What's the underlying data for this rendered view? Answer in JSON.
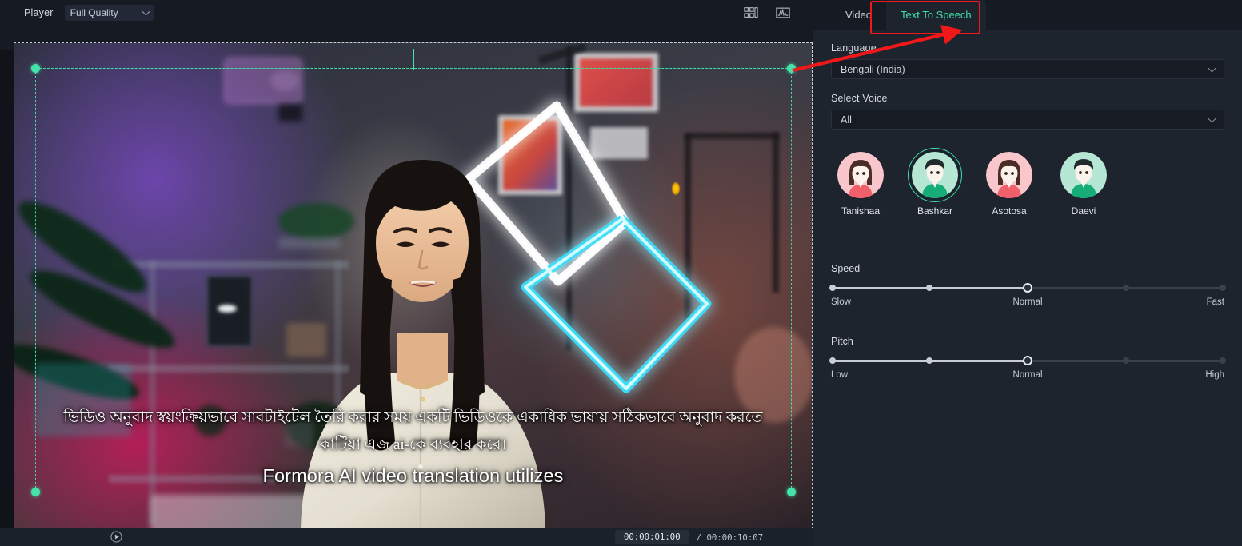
{
  "player": {
    "label": "Player",
    "quality_value": "Full Quality",
    "icons": [
      {
        "name": "layout-grid-icon"
      },
      {
        "name": "waveform-scope-icon"
      }
    ],
    "transport": {
      "play_icon": "play-icon",
      "current_time": "00:00:01:00",
      "total_time": "/ 00:00:10:07"
    }
  },
  "video": {
    "subtitle_bengali": "ভিডিও অনুবাদ স্বয়ংক্রিয়ভাবে সাবটাইটেল তৈরি করার সময় একটি ভিডিওকে একাধিক ভাষায় সঠিকভাবে অনুবাদ করতে কাটিয়া এজ ai-কে ব্যবহার করে।",
    "subtitle_english": "Formora AI video translation utilizes"
  },
  "panel": {
    "tabs": [
      {
        "label": "Video",
        "active": false
      },
      {
        "label": "Text To Speech",
        "active": true
      }
    ],
    "language": {
      "label": "Language",
      "value": "Bengali (India)"
    },
    "select_voice": {
      "label": "Select Voice",
      "value": "All"
    },
    "voices": [
      {
        "name": "Tanishaa",
        "gender": "female",
        "selected": false,
        "bg": "#f9c7cb",
        "hair": "#4a2e26",
        "shirt": "#f0606a"
      },
      {
        "name": "Bashkar",
        "gender": "male",
        "selected": true,
        "bg": "#b6e6d4",
        "hair": "#232a2e",
        "shirt": "#17ad78"
      },
      {
        "name": "Asotosa",
        "gender": "female",
        "selected": false,
        "bg": "#f9c7cb",
        "hair": "#4a2e26",
        "shirt": "#f0606a"
      },
      {
        "name": "Daevi",
        "gender": "male",
        "selected": false,
        "bg": "#b6e6d4",
        "hair": "#232a2e",
        "shirt": "#17ad78"
      }
    ],
    "speed": {
      "title": "Speed",
      "min_label": "Slow",
      "mid_label": "Normal",
      "max_label": "Fast",
      "value_index": 2,
      "steps": 5
    },
    "pitch": {
      "title": "Pitch",
      "min_label": "Low",
      "mid_label": "Normal",
      "max_label": "High",
      "value_index": 2,
      "steps": 5
    }
  },
  "annotation": {
    "highlight_color": "#f01818",
    "arrow_color": "#f01818",
    "target": "Text To Speech"
  },
  "colors": {
    "accent_green": "#3fe0a8",
    "panel_bg": "#1e242e",
    "toolbar_bg": "#161b23",
    "selection_green": "#45e0a8"
  }
}
